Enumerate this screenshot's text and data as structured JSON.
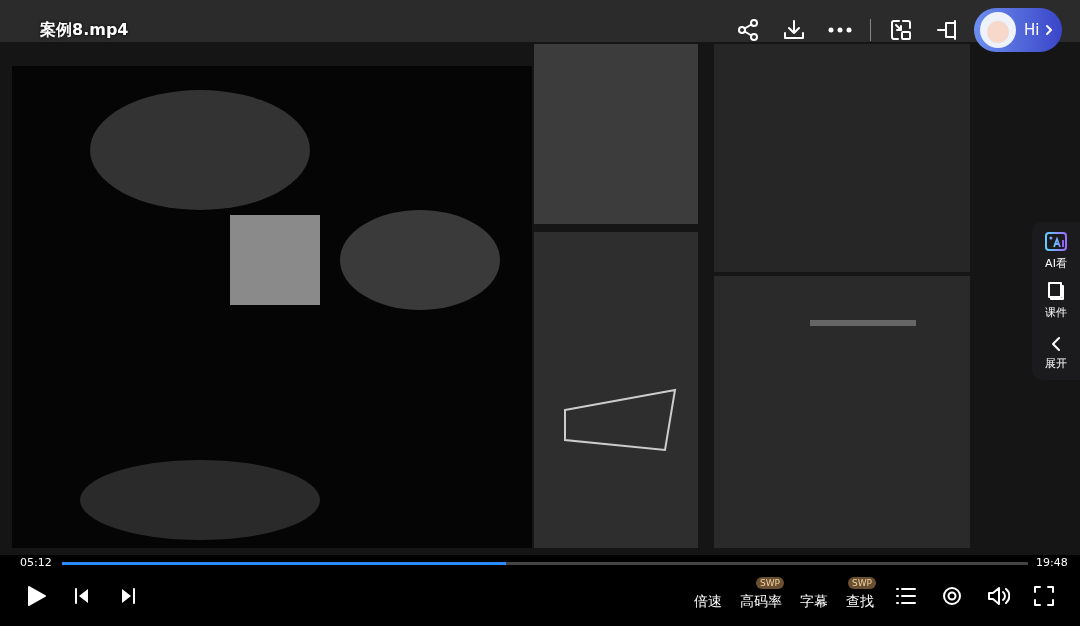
{
  "video": {
    "title": "案例8.mp4"
  },
  "assistant": {
    "label": "Hi"
  },
  "side_panel": [
    {
      "kind": "ai",
      "label": "AI看"
    },
    {
      "kind": "courseware",
      "label": "课件"
    },
    {
      "kind": "expand",
      "label": "展开"
    }
  ],
  "playback": {
    "current": "05:12",
    "duration": "19:48",
    "level": 0.46,
    "playing": false
  },
  "controls": [
    {
      "label": "倍速"
    },
    {
      "label": "高码率",
      "badge": "SWP"
    },
    {
      "label": "字幕"
    },
    {
      "label": "查找",
      "badge": "SWP"
    }
  ]
}
